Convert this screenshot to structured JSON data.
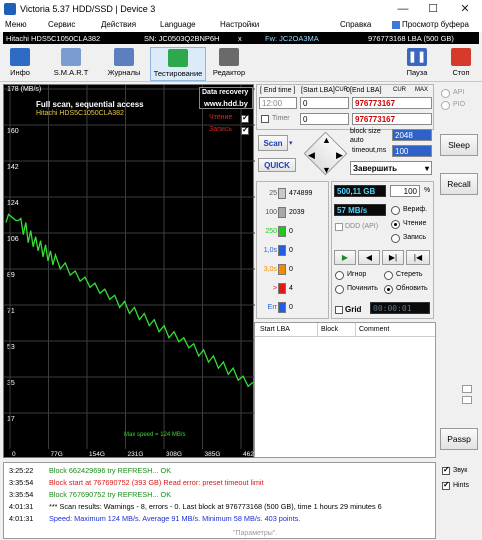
{
  "window": {
    "title": "Victoria 5.37 HDD/SSD | Device 3"
  },
  "menu": [
    "Меню",
    "Сервис",
    "Действия",
    "Language",
    "Настройки",
    "Справка",
    "Просмотр буфера"
  ],
  "info": {
    "model": "Hitachi HDS5C1050CLA382",
    "sn": "SN: JC0503Q2BNP6H",
    "x": "x",
    "fw": "Fw: JC2OA3MA",
    "capacity": "976773168 LBA (500 GB)"
  },
  "toolbar": {
    "info": "Инфо",
    "smart": "S.M.A.R.T",
    "journals": "Журналы",
    "testing": "Тестирование",
    "editor": "Редактор",
    "pause": "Пауза",
    "stop": "Стоп"
  },
  "graph": {
    "watermark1": "Data recovery",
    "watermark2": "www.hdd.by",
    "scan_title": "Full scan, sequential access",
    "model": "Hitachi HDS5C1050CLA382",
    "read_label": "Чтение",
    "write_label": "Запись",
    "max_speed": "Max speed = 124 MB/s",
    "y_ticks": [
      "178 (MB/s)",
      "160",
      "142",
      "124",
      "106",
      "89",
      "71",
      "53",
      "35",
      "17"
    ],
    "x_ticks": [
      "0",
      "77G",
      "154G",
      "231G",
      "308G",
      "385G",
      "462G"
    ],
    "speed_curve": [
      [
        0,
        110
      ],
      [
        5,
        118
      ],
      [
        10,
        113
      ],
      [
        15,
        116
      ],
      [
        20,
        111
      ],
      [
        25,
        115
      ],
      [
        30,
        112
      ],
      [
        35,
        108
      ],
      [
        40,
        110
      ],
      [
        45,
        104
      ],
      [
        50,
        106
      ],
      [
        55,
        102
      ],
      [
        60,
        103
      ],
      [
        65,
        100
      ],
      [
        70,
        101
      ],
      [
        75,
        97
      ],
      [
        80,
        99
      ],
      [
        85,
        95
      ],
      [
        90,
        96
      ],
      [
        95,
        93
      ],
      [
        100,
        94
      ],
      [
        110,
        91
      ],
      [
        120,
        90
      ],
      [
        130,
        88
      ],
      [
        140,
        86
      ],
      [
        150,
        85
      ],
      [
        160,
        83
      ],
      [
        170,
        82
      ],
      [
        180,
        80
      ],
      [
        190,
        79
      ],
      [
        200,
        77
      ],
      [
        210,
        76
      ],
      [
        220,
        74
      ],
      [
        230,
        72
      ],
      [
        240,
        71
      ],
      [
        250,
        69
      ],
      [
        260,
        68
      ],
      [
        270,
        66
      ],
      [
        280,
        65
      ],
      [
        290,
        63
      ],
      [
        300,
        62
      ],
      [
        310,
        60
      ],
      [
        320,
        59
      ],
      [
        330,
        57
      ],
      [
        340,
        56
      ],
      [
        350,
        55
      ],
      [
        360,
        53
      ],
      [
        370,
        52
      ],
      [
        380,
        50
      ],
      [
        390,
        48
      ],
      [
        400,
        47
      ],
      [
        410,
        45
      ],
      [
        420,
        44
      ],
      [
        430,
        42
      ],
      [
        440,
        41
      ],
      [
        450,
        39
      ],
      [
        460,
        38
      ],
      [
        470,
        36
      ],
      [
        480,
        34
      ],
      [
        490,
        33
      ],
      [
        500,
        31
      ]
    ]
  },
  "panel": {
    "end_time": "[ End time ]",
    "start_lba": "[Start LBA]",
    "cur": "CUR",
    "zero": "0",
    "end_lba": "[End LBA]",
    "cur2": "CUR",
    "max": "MAX",
    "time_val": "12:00",
    "start_val": "0",
    "end_val": "976773167",
    "end_val2": "976773167",
    "timer": "Timer",
    "timer_val": "0",
    "block_size": "block size",
    "auto": "auto",
    "block_val": "2048",
    "timeout": "timeout,ms",
    "timeout_val": "100",
    "scan": "Scan",
    "quick": "QUICK",
    "action": "Завершить",
    "api": "API",
    "pio": "PIO",
    "sleep": "Sleep",
    "recall": "Recall",
    "passp": "Passp"
  },
  "counts": [
    {
      "label": "25",
      "value": "474899",
      "color": "#c8c8c8"
    },
    {
      "label": "100",
      "value": "2039",
      "color": "#a8a8a8"
    },
    {
      "label": "250",
      "value": "0",
      "color": "#22c522"
    },
    {
      "label": "1,0s",
      "value": "0",
      "color": "#1f5fe0"
    },
    {
      "label": "3,0s",
      "value": "0",
      "color": "#f08c00"
    },
    {
      "label": ">",
      "value": "4",
      "color": "#e01818"
    },
    {
      "label": "Err",
      "value": "0",
      "color": "#1f5fe0"
    }
  ],
  "status": {
    "size": "500,11 GB",
    "percent": "100",
    "percent_sign": "%",
    "speed": "57 MB/s",
    "verify": "Вериф.",
    "read": "Чтение",
    "write": "Запись",
    "ddd": "DDD (API)",
    "ignore": "Игнор",
    "erase": "Стереть",
    "remap": "Починить",
    "refresh": "Обновить",
    "grid": "Grid",
    "clock": "00:00:01"
  },
  "table": {
    "headers": [
      "Start LBA",
      "Block",
      "Comment"
    ]
  },
  "log": [
    {
      "time": "3:25:22",
      "msg": "Block 662429696 try REFRESH... OK",
      "color": "#1a8a1a"
    },
    {
      "time": "3:35:54",
      "msg": "Block start at 767690752 (393 GB) Read error: preset timeout limit",
      "color": "#d81818"
    },
    {
      "time": "3:35:54",
      "msg": "Block 767690752 try REFRESH... OK",
      "color": "#1a8a1a"
    },
    {
      "time": "4:01:31",
      "msg": "*** Scan results: Warnings - 8, errors - 0. Last block at 976773168 (500 GB), time 1 hours 29 minutes 6",
      "color": "#000000"
    },
    {
      "time": "4:01:31",
      "msg": "Speed: Maximum 124 MB/s. Average 91 MB/s. Minimum 58 MB/s. 403 points.",
      "color": "#1b2fd6"
    }
  ],
  "log_side": {
    "sound": "Звук",
    "hints": "Hints"
  },
  "watermark": "\"Параметры\"."
}
